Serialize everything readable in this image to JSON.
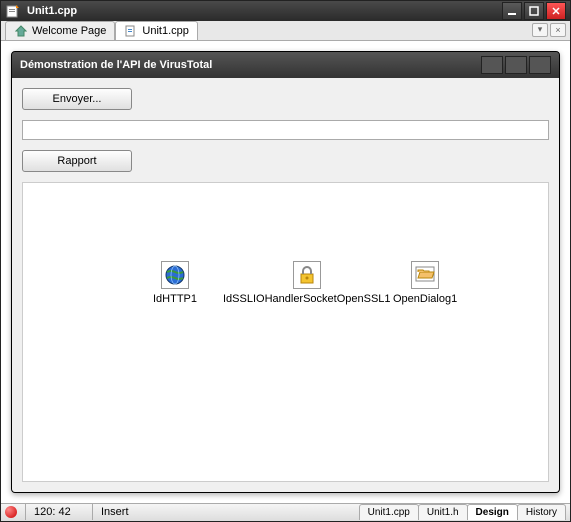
{
  "window": {
    "title": "Unit1.cpp"
  },
  "tabs": {
    "welcome": "Welcome Page",
    "unit1": "Unit1.cpp"
  },
  "form": {
    "title": "Démonstration de l'API de VirusTotal",
    "send_btn": "Envoyer...",
    "report_btn": "Rapport",
    "textfield_value": ""
  },
  "components": {
    "idhttp": "IdHTTP1",
    "idssl": "IdSSLIOHandlerSocketOpenSSL1",
    "opendialog": "OpenDialog1"
  },
  "statusbar": {
    "pos": "120: 42",
    "mode": "Insert",
    "tabs": {
      "unit_cpp": "Unit1.cpp",
      "unit_h": "Unit1.h",
      "design": "Design",
      "history": "History"
    }
  }
}
